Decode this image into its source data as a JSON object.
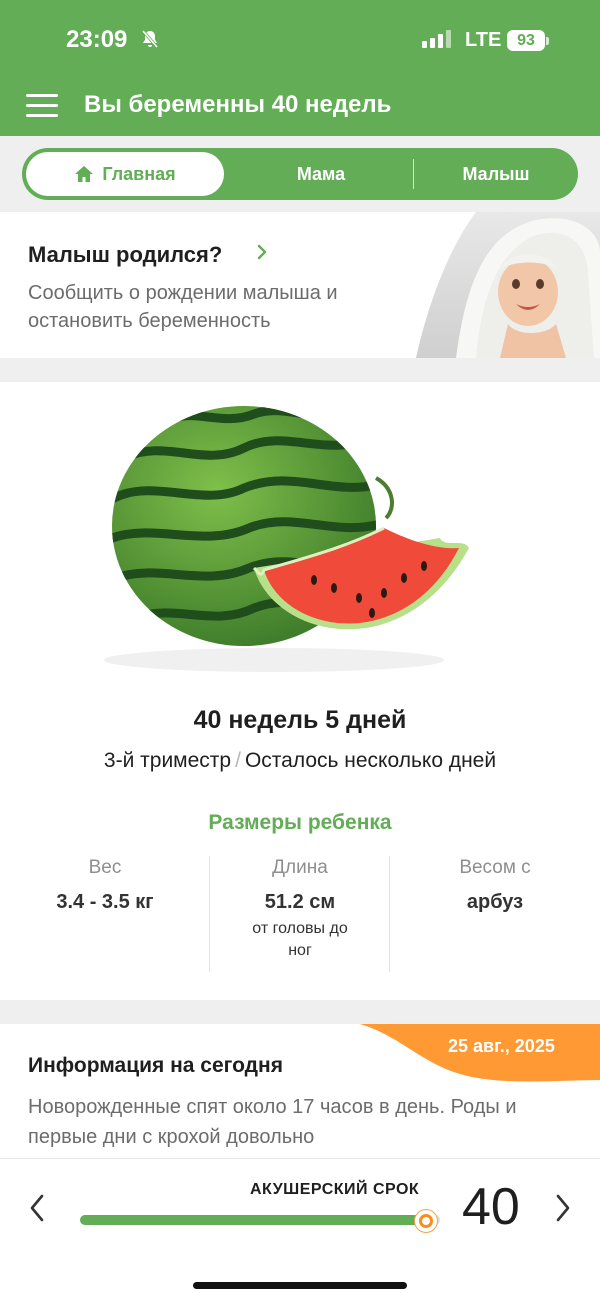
{
  "status_bar": {
    "time": "23:09",
    "network": "LTE",
    "battery": "93",
    "icons": [
      "bell-muted-icon",
      "signal-icon",
      "battery-icon"
    ]
  },
  "header": {
    "title": "Вы беременны 40 недель",
    "menu_icon": "hamburger-menu-icon"
  },
  "tabs": [
    {
      "label": "Главная",
      "icon": "home-icon",
      "active": true
    },
    {
      "label": "Мама",
      "active": false
    },
    {
      "label": "Малыш",
      "active": false
    }
  ],
  "born_card": {
    "title": "Малыш родился?",
    "text": "Сообщить о рождении малыша и остановить беременность"
  },
  "fruit_card": {
    "weeks": "40 недель 5 дней",
    "trimester": "3-й триместр",
    "remaining": "Осталось несколько дней",
    "sizes_title": "Размеры ребенка",
    "stats": [
      {
        "label": "Вес",
        "value": "3.4 - 3.5 кг",
        "sub": ""
      },
      {
        "label": "Длина",
        "value": "51.2 см",
        "sub": "от головы до ног"
      },
      {
        "label": "Весом с",
        "value": "арбуз",
        "sub": ""
      }
    ]
  },
  "info_card": {
    "date": "25 авг., 2025",
    "title": "Информация на сегодня",
    "text": "Новорожденные спят около 17 часов в день. Роды и первые дни с крохой довольно"
  },
  "term_slider": {
    "label": "АКУШЕРСКИЙ СРОК",
    "week": "40",
    "progress": 0.96
  },
  "colors": {
    "brand_green": "#62ad56",
    "accent_orange": "#ff8c1a"
  }
}
